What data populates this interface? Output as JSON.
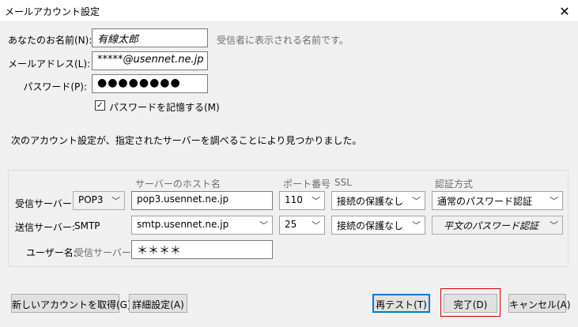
{
  "window": {
    "title": "メールアカウント設定",
    "close_label": "✕"
  },
  "account": {
    "name_label": "あなたのお名前(N):",
    "name_value": "有線太郎",
    "name_hint": "受信者に表示される名前です。",
    "email_label": "メールアドレス(L):",
    "email_value": "*****@usennet.ne.jp",
    "password_label": "パスワード(P):",
    "password_value": "●●●●●●●●",
    "remember_label": "パスワードを記憶する(M)",
    "remember_checked": true
  },
  "message": "次のアカウント設定が、指定されたサーバーを調べることにより見つかりました。",
  "servers": {
    "headers": {
      "host": "サーバーのホスト名",
      "port": "ポート番号",
      "ssl": "SSL",
      "auth": "認証方式"
    },
    "incoming": {
      "label": "受信サーバー:",
      "protocol": "POP3",
      "host": "pop3.usennet.ne.jp",
      "port": "110",
      "ssl": "接続の保護なし",
      "auth": "通常のパスワード認証"
    },
    "outgoing": {
      "label": "送信サーバー:",
      "protocol": "SMTP",
      "host": "smtp.usennet.ne.jp",
      "port": "25",
      "ssl": "接続の保護なし",
      "auth": "平文のパスワード認証"
    },
    "username": {
      "label": "ユーザー名:",
      "server_label": "受信サーバー:",
      "value": "＊＊＊＊"
    }
  },
  "buttons": {
    "get_new_account": "新しいアカウントを取得(G)",
    "advanced": "詳細設定(A)",
    "retest": "再テスト(T)",
    "done": "完了(D)",
    "cancel": "キャンセル(A)"
  },
  "icons": {
    "dropdown": "chevron-down-icon",
    "checkmark": "check-icon",
    "close": "close-icon"
  },
  "colors": {
    "accent": "#0078d7",
    "highlight_frame": "#d20000"
  }
}
